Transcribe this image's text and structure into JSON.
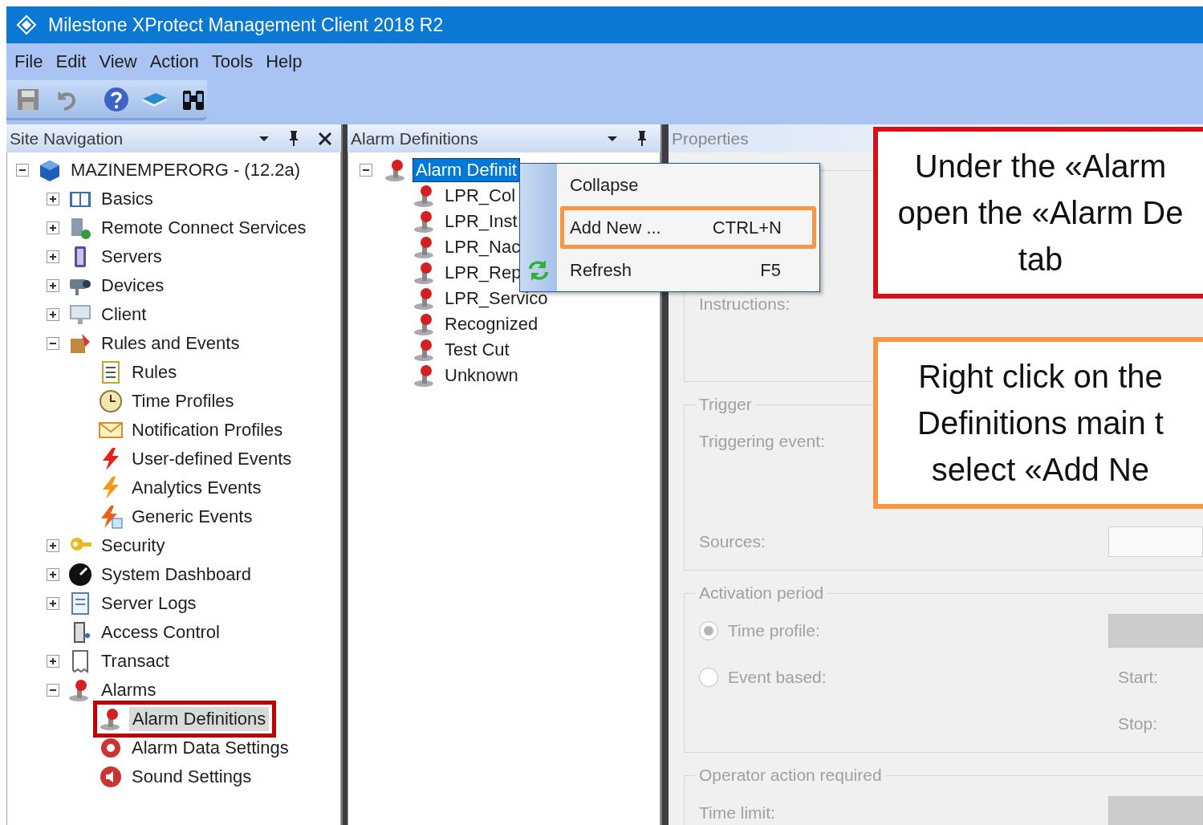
{
  "window": {
    "title": "Milestone XProtect Management Client 2018 R2"
  },
  "menu": [
    "File",
    "Edit",
    "View",
    "Action",
    "Tools",
    "Help"
  ],
  "site_navigation": {
    "title": "Site Navigation",
    "tree": [
      {
        "label": "MAZINEMPERORG - (12.2a)",
        "expanded": true,
        "selected": false,
        "annotated": false,
        "children": [
          {
            "label": "Basics",
            "expanded": false,
            "selected": false,
            "annotated": false
          },
          {
            "label": "Remote Connect Services",
            "expanded": false,
            "selected": false,
            "annotated": false
          },
          {
            "label": "Servers",
            "expanded": false,
            "selected": false,
            "annotated": false
          },
          {
            "label": "Devices",
            "expanded": false,
            "selected": false,
            "annotated": false
          },
          {
            "label": "Client",
            "expanded": false,
            "selected": false,
            "annotated": false
          },
          {
            "label": "Rules and Events",
            "expanded": true,
            "selected": false,
            "annotated": false,
            "children": [
              {
                "label": "Rules",
                "selected": false,
                "annotated": false
              },
              {
                "label": "Time Profiles",
                "selected": false,
                "annotated": false
              },
              {
                "label": "Notification Profiles",
                "selected": false,
                "annotated": false
              },
              {
                "label": "User-defined Events",
                "selected": false,
                "annotated": false
              },
              {
                "label": "Analytics Events",
                "selected": false,
                "annotated": false
              },
              {
                "label": "Generic Events",
                "selected": false,
                "annotated": false
              }
            ]
          },
          {
            "label": "Security",
            "expanded": false,
            "selected": false,
            "annotated": false
          },
          {
            "label": "System Dashboard",
            "expanded": false,
            "selected": false,
            "annotated": false
          },
          {
            "label": "Server Logs",
            "expanded": false,
            "selected": false,
            "annotated": false
          },
          {
            "label": "Access Control",
            "selected": false,
            "annotated": false
          },
          {
            "label": "Transact",
            "expanded": false,
            "selected": false,
            "annotated": false
          },
          {
            "label": "Alarms",
            "expanded": true,
            "selected": false,
            "annotated": false,
            "children": [
              {
                "label": "Alarm Definitions",
                "selected": true,
                "annotated": true
              },
              {
                "label": "Alarm Data Settings",
                "selected": false,
                "annotated": false
              },
              {
                "label": "Sound Settings",
                "selected": false,
                "annotated": false
              }
            ]
          }
        ]
      }
    ]
  },
  "alarm_definitions": {
    "title": "Alarm Definitions",
    "tree": [
      {
        "label": "Alarm Definit",
        "expanded": true,
        "selected": true,
        "children": [
          {
            "label": "LPR_Col",
            "selected": false
          },
          {
            "label": "LPR_Inst",
            "selected": false
          },
          {
            "label": "LPR_Nac",
            "selected": false
          },
          {
            "label": "LPR_Rep",
            "selected": false
          },
          {
            "label": "LPR_Servico",
            "selected": false
          },
          {
            "label": "Recognized",
            "selected": false
          },
          {
            "label": "Test Cut",
            "selected": false
          },
          {
            "label": "Unknown",
            "selected": false
          }
        ]
      }
    ]
  },
  "context_menu": {
    "items": [
      {
        "label": "Collapse",
        "annotated": false
      },
      {
        "label": "Add New ...",
        "shortcut": "CTRL+N",
        "annotated": true
      },
      {
        "label": "Refresh",
        "shortcut": "F5",
        "annotated": false
      }
    ]
  },
  "properties": {
    "title": "Properties",
    "disabled": true,
    "groups": [
      {
        "rows": [
          {
            "kind": "text",
            "label": "Instructions:"
          }
        ]
      },
      {
        "title": "Trigger",
        "rows": [
          {
            "kind": "text",
            "label": "Triggering event:"
          },
          {
            "kind": "input",
            "label": "Sources:"
          }
        ]
      },
      {
        "title": "Activation period",
        "rows": [
          {
            "kind": "radio-select",
            "label": "Time profile:",
            "selected": true
          },
          {
            "kind": "radio",
            "label": "Event based:",
            "selected": false,
            "aside": "Start:"
          },
          {
            "kind": "aside",
            "aside": "Stop:"
          }
        ]
      },
      {
        "title": "Operator action required",
        "rows": [
          {
            "kind": "select",
            "label": "Time limit:"
          }
        ]
      }
    ]
  },
  "annotations": [
    {
      "color": "#d0121b",
      "lines": [
        "Under the «Alarm",
        "open the «Alarm De",
        "tab"
      ]
    },
    {
      "color": "#f79646",
      "lines": [
        "Right click on the",
        "Definitions main t",
        "select «Add Ne"
      ]
    }
  ]
}
